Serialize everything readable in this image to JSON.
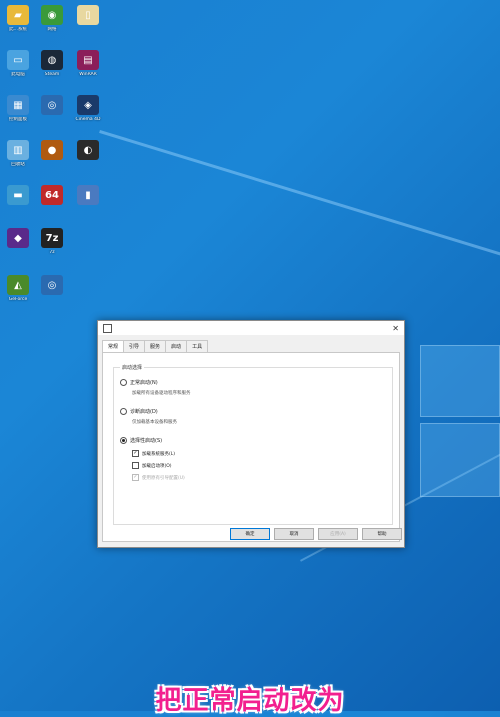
{
  "desktop": {
    "icons": [
      {
        "name": "folder-icon",
        "label": "此...系统",
        "sym": "▰",
        "color": "#e8b93a"
      },
      {
        "name": "network-icon",
        "label": "网络",
        "sym": "◉",
        "color": "#3a9a3a"
      },
      {
        "name": "file-icon",
        "label": "",
        "sym": "▯",
        "color": "#e8d8a0"
      },
      {
        "name": "computer-icon",
        "label": "此电脑",
        "sym": "▭",
        "color": "#4aa3e0"
      },
      {
        "name": "steam-icon",
        "label": "Steam",
        "sym": "◍",
        "color": "#1b2838"
      },
      {
        "name": "winrar-icon",
        "label": "WinRAR",
        "sym": "▤",
        "color": "#8b1e5a"
      },
      {
        "name": "control-panel-icon",
        "label": "控制面板",
        "sym": "▦",
        "color": "#3a8ad0"
      },
      {
        "name": "disc-icon",
        "label": "",
        "sym": "◎",
        "color": "#2a6ab0"
      },
      {
        "name": "cinema-icon",
        "label": "Cinema 4D",
        "sym": "◈",
        "color": "#1a3a6a"
      },
      {
        "name": "recycle-bin-icon",
        "label": "回收站",
        "sym": "▥",
        "color": "#6ab0e0"
      },
      {
        "name": "app-icon",
        "label": "",
        "sym": "●",
        "color": "#b05a10"
      },
      {
        "name": "nvidia-icon",
        "label": "",
        "sym": "◐",
        "color": "#2a2a2a"
      },
      {
        "name": "monitor-icon",
        "label": "",
        "sym": "▬",
        "color": "#3a9ad0"
      },
      {
        "name": "64-icon",
        "label": "",
        "sym": "64",
        "color": "#c02a2a"
      },
      {
        "name": "doc-icon",
        "label": "",
        "sym": "▮",
        "color": "#4a7ac0"
      },
      {
        "name": "purple-app-icon",
        "label": "",
        "sym": "◆",
        "color": "#5a2a8a"
      },
      {
        "name": "7zip-icon",
        "label": "7z",
        "sym": "7z",
        "color": "#222"
      },
      {
        "name": "geforce-icon",
        "label": "GeForce",
        "sym": "◭",
        "color": "#4a8a2a"
      },
      {
        "name": "disc2-icon",
        "label": "",
        "sym": "◎",
        "color": "#2a6ab0"
      }
    ]
  },
  "dialog": {
    "tabs": [
      "常规",
      "引导",
      "服务",
      "启动",
      "工具"
    ],
    "group_title": "启动选择",
    "normal_label": "正常启动(N)",
    "normal_desc": "加载所有设备驱动程序和服务",
    "diag_label": "诊断启动(D)",
    "diag_desc": "仅加载基本设备和服务",
    "selective_label": "选择性启动(S)",
    "load_services": "加载系统服务(L)",
    "load_startup": "加载启动项(O)",
    "use_original": "使用原有引导配置(U)",
    "buttons": {
      "ok": "确定",
      "cancel": "取消",
      "apply": "应用(A)",
      "help": "帮助"
    }
  },
  "caption": "把正常启动改为"
}
